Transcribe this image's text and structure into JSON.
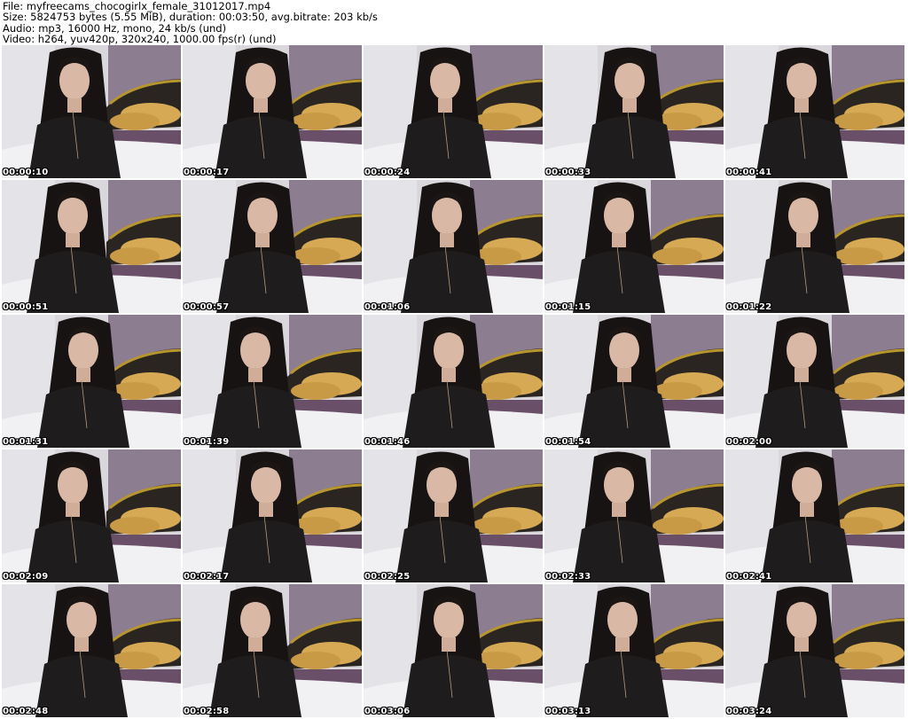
{
  "header": {
    "file_line": "File: myfreecams_chocogirlx_female_31012017.mp4",
    "size_line": "Size: 5824753 bytes (5.55 MiB), duration: 00:03:50, avg.bitrate: 203 kb/s",
    "audio_line": "Audio: mp3, 16000 Hz, mono, 24 kb/s (und)",
    "video_line": "Video: h264, yuv420p, 320x240, 1000.00 fps(r) (und)"
  },
  "thumbnails": [
    "00:00:10",
    "00:00:17",
    "00:00:24",
    "00:00:33",
    "00:00:41",
    "00:00:51",
    "00:00:57",
    "00:01:06",
    "00:01:15",
    "00:01:22",
    "00:01:31",
    "00:01:39",
    "00:01:46",
    "00:01:54",
    "00:02:00",
    "00:02:09",
    "00:02:17",
    "00:02:25",
    "00:02:33",
    "00:02:41",
    "00:02:48",
    "00:02:58",
    "00:03:06",
    "00:03:13",
    "00:03:24"
  ]
}
